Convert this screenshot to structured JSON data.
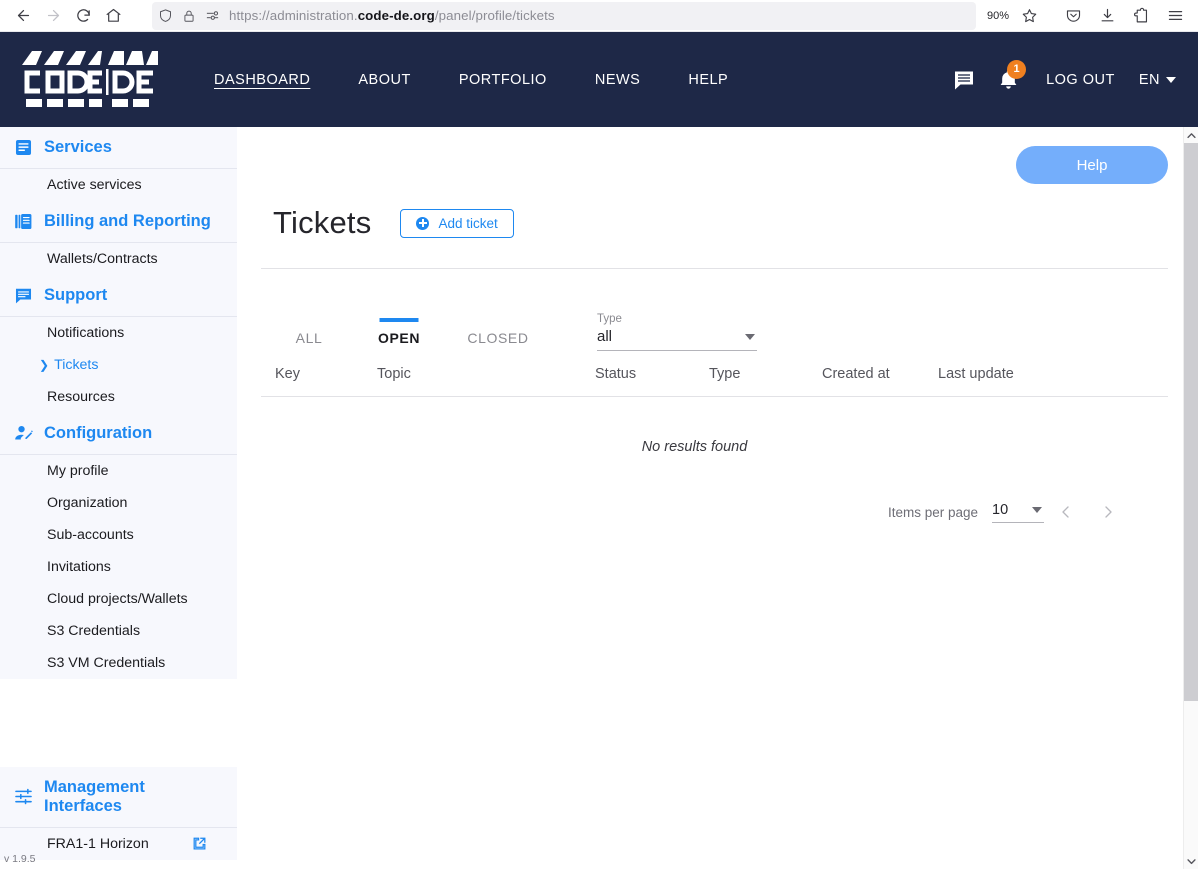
{
  "browser": {
    "back_icon": "arrow-left-icon",
    "forward_icon": "arrow-right-icon",
    "reload_icon": "reload-icon",
    "home_icon": "home-icon",
    "shield_icon": "shield-icon",
    "lock_icon": "lock-icon",
    "permissions_icon": "permissions-icon",
    "url_scheme": "https://administration.",
    "url_host": "code-de.org",
    "url_path": "/panel/profile/tickets",
    "zoom_level": "90%",
    "bookmark_icon": "star-icon",
    "pocket_icon": "pocket-icon",
    "downloads_icon": "download-icon",
    "extensions_icon": "extensions-icon",
    "menu_icon": "hamburger-menu-icon"
  },
  "header": {
    "logo_text": "CODE|DE",
    "nav": [
      {
        "label": "DASHBOARD",
        "active": true
      },
      {
        "label": "ABOUT",
        "active": false
      },
      {
        "label": "PORTFOLIO",
        "active": false
      },
      {
        "label": "NEWS",
        "active": false
      },
      {
        "label": "HELP",
        "active": false
      }
    ],
    "messages_icon": "message-icon",
    "notifications_icon": "bell-icon",
    "notification_count": "1",
    "logout_label": "LOG OUT",
    "language": "EN",
    "brand_navy": "#1e2847",
    "accent_blue": "#1e88f0",
    "badge_orange": "#f08020"
  },
  "sidebar": {
    "sections": [
      {
        "title": "Services",
        "icon": "article-list-icon",
        "items": [
          {
            "label": "Active services",
            "active": false
          }
        ]
      },
      {
        "title": "Billing and Reporting",
        "icon": "library-books-icon",
        "items": [
          {
            "label": "Wallets/Contracts",
            "active": false
          }
        ]
      },
      {
        "title": "Support",
        "icon": "comment-icon",
        "items": [
          {
            "label": "Notifications",
            "active": false
          },
          {
            "label": "Tickets",
            "active": true
          },
          {
            "label": "Resources",
            "active": false
          }
        ]
      },
      {
        "title": "Configuration",
        "icon": "manage-accounts-icon",
        "items": [
          {
            "label": "My profile",
            "active": false
          },
          {
            "label": "Organization",
            "active": false
          },
          {
            "label": "Sub-accounts",
            "active": false
          },
          {
            "label": "Invitations",
            "active": false
          },
          {
            "label": "Cloud projects/Wallets",
            "active": false
          },
          {
            "label": "S3 Credentials",
            "active": false
          },
          {
            "label": "S3 VM Credentials",
            "active": false
          }
        ]
      }
    ],
    "management": {
      "title": "Management Interfaces",
      "icon": "tune-sliders-icon",
      "items": [
        {
          "label": "FRA1-1 Horizon",
          "external_icon": "open-in-new-icon"
        }
      ]
    },
    "version": "v 1.9.5"
  },
  "main": {
    "help_button": "Help",
    "page_title": "Tickets",
    "add_ticket_label": "Add ticket",
    "add_ticket_icon": "plus-circle-icon",
    "tabs": [
      {
        "label": "ALL",
        "active": false
      },
      {
        "label": "OPEN",
        "active": true
      },
      {
        "label": "CLOSED",
        "active": false
      }
    ],
    "type_filter": {
      "label": "Type",
      "value": "all",
      "arrow_icon": "chevron-down-icon"
    },
    "table": {
      "columns": [
        "Key",
        "Topic",
        "Status",
        "Type",
        "Created at",
        "Last update"
      ],
      "rows": [],
      "empty_message": "No results found"
    },
    "paginator": {
      "items_per_page_label": "Items per page",
      "items_per_page_value": "10",
      "prev_icon": "chevron-left-icon",
      "next_icon": "chevron-right-icon"
    }
  },
  "scrollbar": {
    "up_icon": "chevron-up-icon",
    "down_icon": "chevron-down-icon"
  }
}
